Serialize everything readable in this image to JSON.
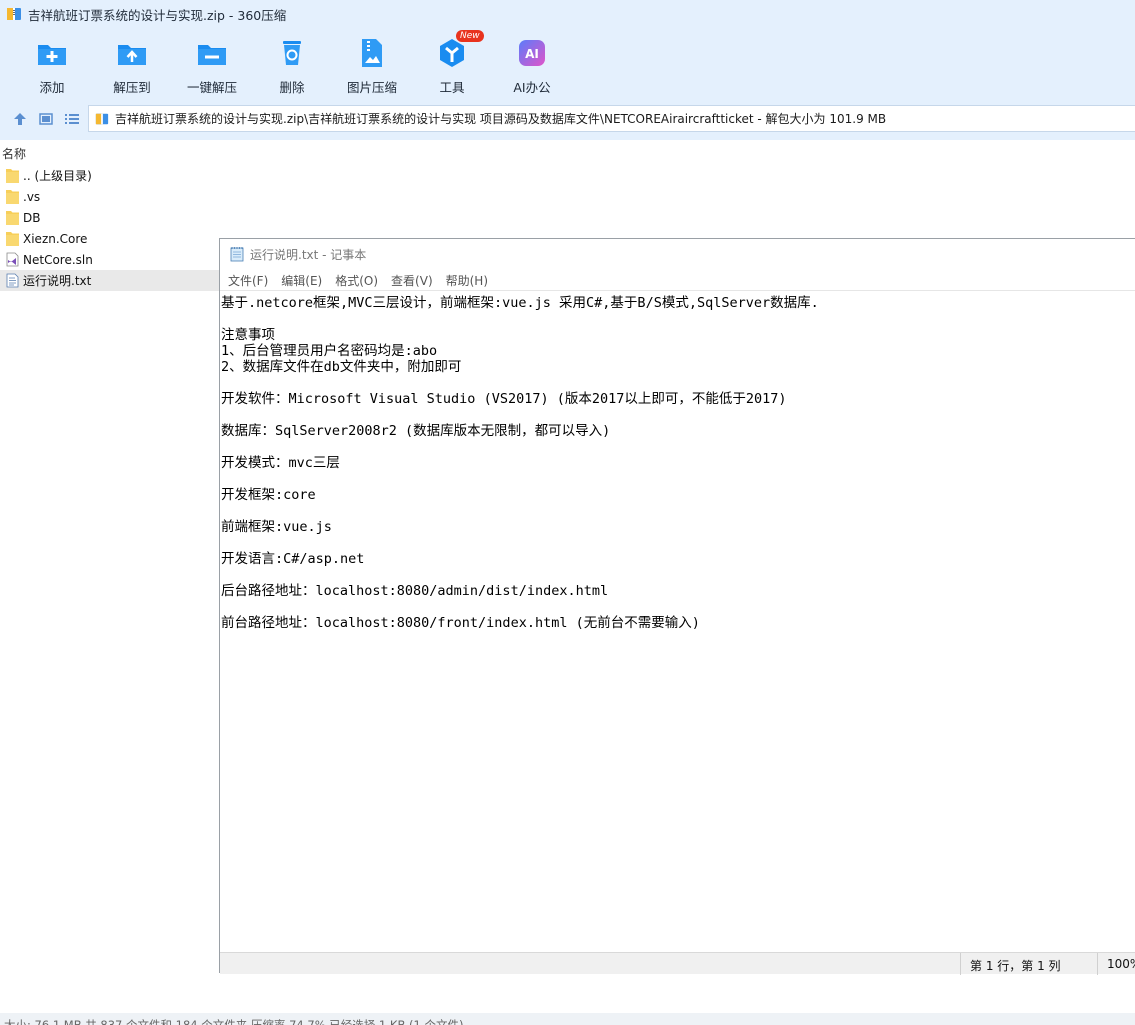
{
  "window": {
    "title": "吉祥航班订票系统的设计与实现.zip - 360压缩"
  },
  "toolbar": [
    {
      "label": "添加",
      "icon": "add-icon"
    },
    {
      "label": "解压到",
      "icon": "extract-to-icon"
    },
    {
      "label": "一键解压",
      "icon": "one-click-extract-icon"
    },
    {
      "label": "删除",
      "icon": "delete-icon"
    },
    {
      "label": "图片压缩",
      "icon": "image-compress-icon"
    },
    {
      "label": "工具",
      "icon": "tools-icon",
      "badge": "New"
    },
    {
      "label": "AI办公",
      "icon": "ai-office-icon",
      "glyph": "AI"
    }
  ],
  "address": {
    "path": "吉祥航班订票系统的设计与实现.zip\\吉祥航班订票系统的设计与实现 项目源码及数据库文件\\NETCOREAiraircraftticket - 解包大小为 101.9 MB"
  },
  "list": {
    "column_name": "名称",
    "items": [
      {
        "name": ".. (上级目录)",
        "type": "folder"
      },
      {
        "name": ".vs",
        "type": "folder"
      },
      {
        "name": "DB",
        "type": "folder"
      },
      {
        "name": "Xiezn.Core",
        "type": "folder"
      },
      {
        "name": "NetCore.sln",
        "type": "sln"
      },
      {
        "name": "运行说明.txt",
        "type": "txt",
        "selected": true
      }
    ]
  },
  "status": {
    "text": "大小: 76.1 MB 共 837 个文件和 184 个文件夹 压缩率 74.7% 已经选择 1 KB (1 个文件)"
  },
  "notepad": {
    "title": "运行说明.txt - 记事本",
    "menu": [
      "文件(F)",
      "编辑(E)",
      "格式(O)",
      "查看(V)",
      "帮助(H)"
    ],
    "lines": [
      "基于.netcore框架,MVC三层设计，前端框架:vue.js 采用C#,基于B/S模式,SqlServer数据库.",
      "注意事项",
      "1、后台管理员用户名密码均是:abo",
      "2、数据库文件在db文件夹中，附加即可",
      "开发软件：Microsoft Visual Studio (VS2017) (版本2017以上即可，不能低于2017)",
      "数据库：SqlServer2008r2 (数据库版本无限制，都可以导入)",
      "开发模式：mvc三层",
      "开发框架:core",
      "前端框架:vue.js",
      "开发语言:C#/asp.net",
      "后台路径地址：localhost:8080/admin/dist/index.html",
      "前台路径地址：localhost:8080/front/index.html (无前台不需要输入)"
    ],
    "status_position": "第 1 行，第 1 列",
    "status_zoom": "100%"
  },
  "colors": {
    "chrome": "#e4f0fd",
    "accent": "#1a8cf0",
    "folder": "#f7cf5a"
  }
}
